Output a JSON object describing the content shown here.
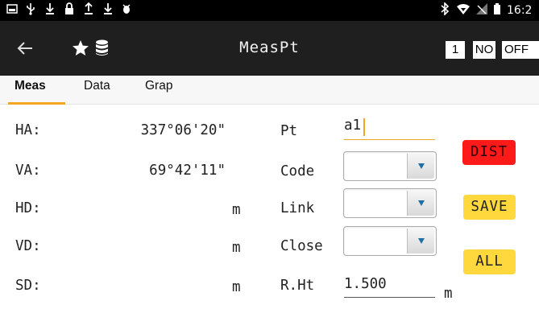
{
  "status_bar": {
    "left_icons": [
      "image-icon",
      "usb-icon",
      "download-icon",
      "lock-icon",
      "upload-icon",
      "upload-icon",
      "download-icon",
      "bug-icon"
    ],
    "right_icons": [
      "bluetooth-icon",
      "wifi-icon",
      "signal-icon",
      "battery-icon"
    ],
    "time": "16:2"
  },
  "app_bar": {
    "title": "MeasPt",
    "chip_number": "1",
    "chip_no": "NO",
    "chip_off": "OFF"
  },
  "tabs": [
    {
      "label": "Meas",
      "active": true
    },
    {
      "label": "Data",
      "active": false
    },
    {
      "label": "Grap",
      "active": false
    }
  ],
  "measurements": {
    "ha": {
      "label": "HA:",
      "value": "337°06'20\"",
      "unit": ""
    },
    "va": {
      "label": "VA:",
      "value": "69°42'11\"",
      "unit": ""
    },
    "hd": {
      "label": "HD:",
      "value": "",
      "unit": "m"
    },
    "vd": {
      "label": "VD:",
      "value": "",
      "unit": "m"
    },
    "sd": {
      "label": "SD:",
      "value": "",
      "unit": "m"
    }
  },
  "point_form": {
    "pt_label": "Pt",
    "pt_value": "a1",
    "code_label": "Code",
    "code_value": "",
    "link_label": "Link",
    "link_value": "",
    "close_label": "Close",
    "close_value": "",
    "rht_label": "R.Ht",
    "rht_value": "1.500",
    "rht_unit": "m"
  },
  "actions": {
    "dist_label": "DIST",
    "save_label": "SAVE",
    "all_label": "ALL"
  },
  "colors": {
    "accent": "#f5a623",
    "dist_button": "#ff1a1a",
    "yellow_button": "#ffd83d",
    "app_bar": "#1f1f1f"
  }
}
